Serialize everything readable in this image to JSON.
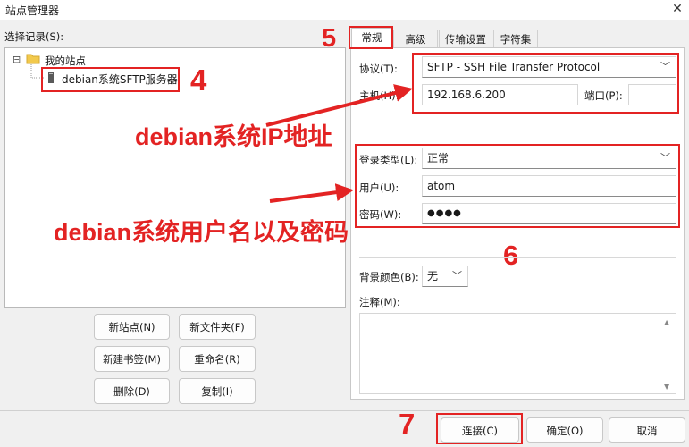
{
  "window": {
    "title": "站点管理器",
    "close": "✕"
  },
  "left": {
    "select_label": "选择记录(S):",
    "tree": {
      "root": "我的站点",
      "toggle": "⊟",
      "child": "debian系统SFTP服务器"
    },
    "buttons": {
      "new_site": "新站点(N)",
      "new_folder": "新文件夹(F)",
      "new_bookmark": "新建书签(M)",
      "rename": "重命名(R)",
      "delete": "删除(D)",
      "copy": "复制(I)"
    }
  },
  "tabs": [
    "常规",
    "高级",
    "传输设置",
    "字符集"
  ],
  "general": {
    "protocol_label": "协议(T):",
    "protocol_value": "SFTP - SSH File Transfer Protocol",
    "host_label": "主机(H):",
    "host_value": "192.168.6.200",
    "port_label": "端口(P):",
    "port_value": "",
    "logon_label": "登录类型(L):",
    "logon_value": "正常",
    "user_label": "用户(U):",
    "user_value": "atom",
    "password_label": "密码(W):",
    "password_value": "●●●●",
    "bg_label": "背景颜色(B):",
    "bg_value": "无",
    "comment_label": "注释(M):"
  },
  "bottom_buttons": {
    "connect": "连接(C)",
    "ok": "确定(O)",
    "cancel": "取消"
  },
  "annotations": {
    "n4": "4",
    "n5": "5",
    "n6": "6",
    "n7": "7",
    "host_note": "debian系统IP地址",
    "user_note": "debian系统用户名以及密码"
  },
  "colors": {
    "annotation": "#e32323",
    "folder": "#f2c94c"
  }
}
